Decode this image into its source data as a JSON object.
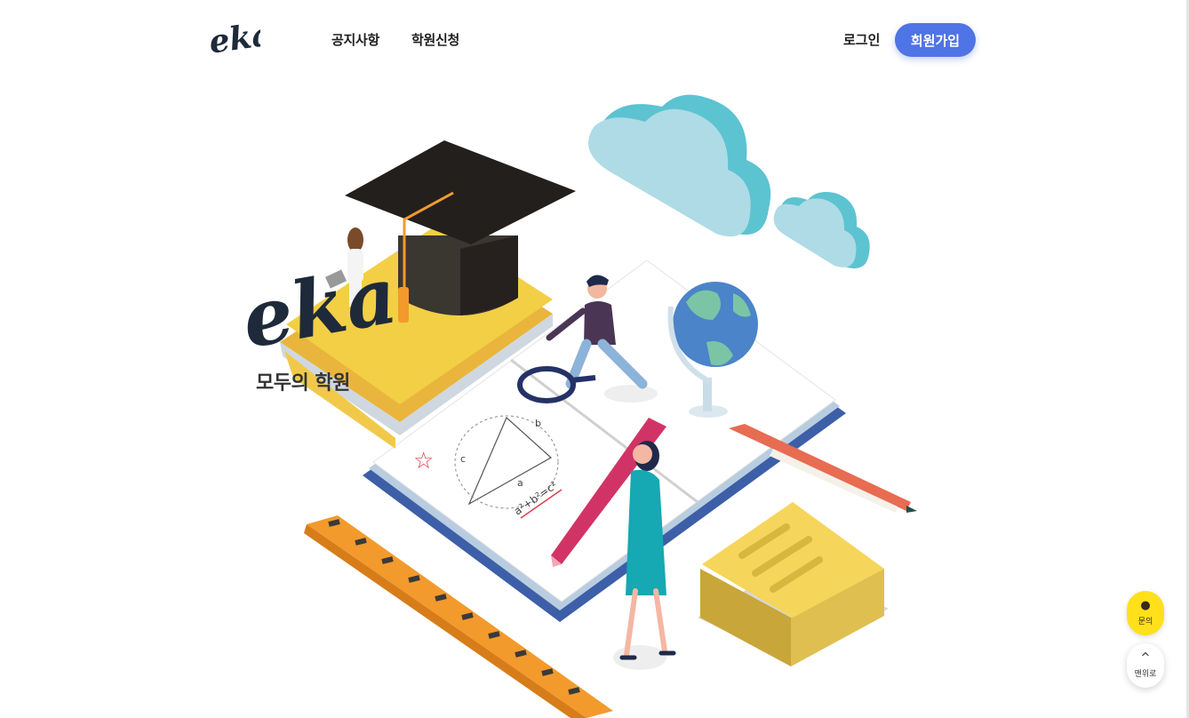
{
  "header": {
    "logo_text": "eka",
    "nav": {
      "notice": "공지사항",
      "apply": "학원신청"
    },
    "login": "로그인",
    "signup": "회원가입"
  },
  "hero": {
    "brand": "eka",
    "subtitle": "모두의 학원",
    "triangle_labels": {
      "a": "a",
      "b": "b",
      "c": "c"
    },
    "formula": "a²+b²=c²"
  },
  "floating": {
    "inquiry_label": "문의",
    "inquiry_icon": "chat-bubble-icon",
    "top_label": "맨위로",
    "top_icon": "chevron-up-icon"
  },
  "colors": {
    "primary": "#4f74e6",
    "kakao_yellow": "#ffe01b",
    "logo_ink": "#1e2a3a"
  }
}
